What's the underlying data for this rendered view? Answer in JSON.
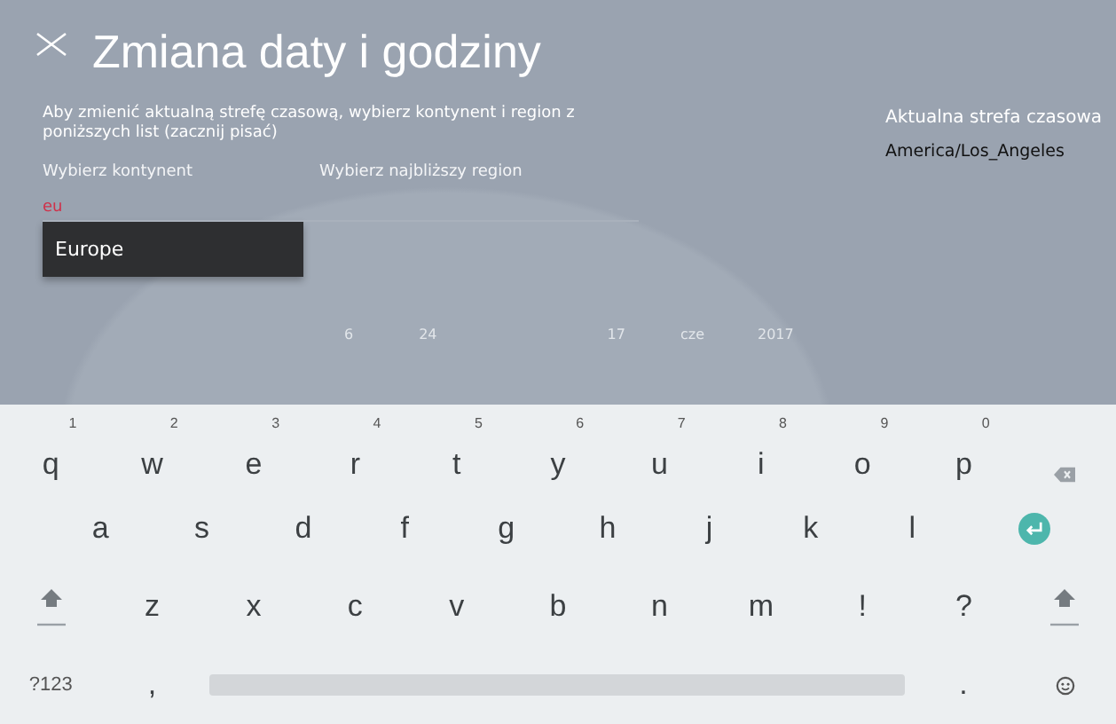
{
  "header": {
    "title": "Zmiana daty i godziny"
  },
  "instructions": "Aby zmienić aktualną strefę czasową, wybierz kontynent i region z poniższych list (zacznij pisać)",
  "continent": {
    "label": "Wybierz kontynent",
    "value": "eu",
    "suggestions": [
      "Europe"
    ]
  },
  "region": {
    "label": "Wybierz najbliższy region"
  },
  "current_timezone": {
    "label": "Aktualna strefa czasowa",
    "value": "America/Los_Angeles"
  },
  "background_date": [
    "6",
    "24",
    "17",
    "cze",
    "2017"
  ],
  "keyboard": {
    "rows": [
      [
        {
          "kind": "letter",
          "label": "q",
          "hint": "1"
        },
        {
          "kind": "letter",
          "label": "w",
          "hint": "2"
        },
        {
          "kind": "letter",
          "label": "e",
          "hint": "3"
        },
        {
          "kind": "letter",
          "label": "r",
          "hint": "4"
        },
        {
          "kind": "letter",
          "label": "t",
          "hint": "5"
        },
        {
          "kind": "letter",
          "label": "y",
          "hint": "6"
        },
        {
          "kind": "letter",
          "label": "u",
          "hint": "7"
        },
        {
          "kind": "letter",
          "label": "i",
          "hint": "8"
        },
        {
          "kind": "letter",
          "label": "o",
          "hint": "9"
        },
        {
          "kind": "letter",
          "label": "p",
          "hint": "0"
        },
        {
          "kind": "backspace"
        }
      ],
      [
        {
          "kind": "letter",
          "label": "a"
        },
        {
          "kind": "letter",
          "label": "s"
        },
        {
          "kind": "letter",
          "label": "d"
        },
        {
          "kind": "letter",
          "label": "f"
        },
        {
          "kind": "letter",
          "label": "g"
        },
        {
          "kind": "letter",
          "label": "h"
        },
        {
          "kind": "letter",
          "label": "j"
        },
        {
          "kind": "letter",
          "label": "k"
        },
        {
          "kind": "letter",
          "label": "l"
        },
        {
          "kind": "enter"
        }
      ],
      [
        {
          "kind": "shift"
        },
        {
          "kind": "letter",
          "label": "z"
        },
        {
          "kind": "letter",
          "label": "x"
        },
        {
          "kind": "letter",
          "label": "c"
        },
        {
          "kind": "letter",
          "label": "v"
        },
        {
          "kind": "letter",
          "label": "b"
        },
        {
          "kind": "letter",
          "label": "n"
        },
        {
          "kind": "letter",
          "label": "m"
        },
        {
          "kind": "letter",
          "label": "!"
        },
        {
          "kind": "letter",
          "label": "?"
        },
        {
          "kind": "shift"
        }
      ]
    ],
    "bottom_row": {
      "symbols_key": "?123",
      "comma_key": ",",
      "period_key": "."
    }
  }
}
